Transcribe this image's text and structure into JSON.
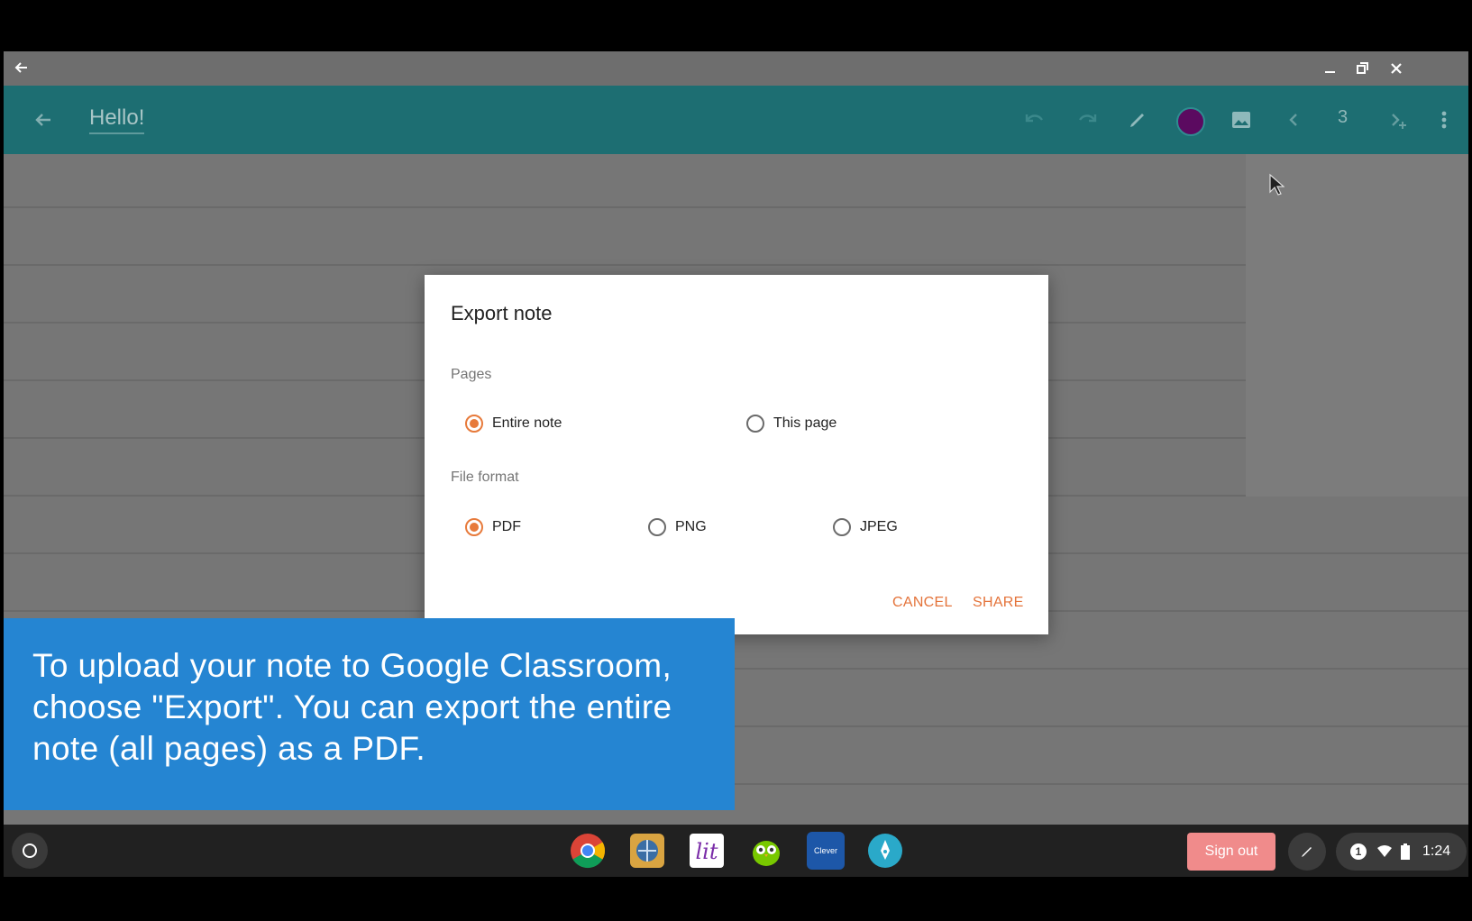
{
  "window": {
    "back_icon": "arrow-left-icon",
    "controls": [
      "minimize-icon",
      "restore-icon",
      "close-icon"
    ]
  },
  "toolbar": {
    "back_icon": "arrow-left-icon",
    "title": "Hello!",
    "icons": [
      "undo-icon",
      "redo-icon",
      "pen-icon",
      "color-swatch",
      "image-icon",
      "chevron-left-icon",
      "add-page-icon",
      "more-vert-icon"
    ],
    "pen_color": "#5b0a60",
    "page_number": "3"
  },
  "dialog": {
    "title": "Export note",
    "pages_label": "Pages",
    "pages_options": [
      {
        "label": "Entire note",
        "checked": true
      },
      {
        "label": "This page",
        "checked": false
      }
    ],
    "format_label": "File format",
    "format_options": [
      {
        "label": "PDF",
        "checked": true
      },
      {
        "label": "PNG",
        "checked": false
      },
      {
        "label": "JPEG",
        "checked": false
      }
    ],
    "cancel_label": "CANCEL",
    "share_label": "SHARE",
    "accent_color": "#e77a3b"
  },
  "caption": {
    "text": "To upload your note to Google Classroom, choose \"Export\". You can export the entire note (all pages) as a PDF."
  },
  "shelf": {
    "apps": [
      "chrome-icon",
      "globe-app-icon",
      "lit-app-icon",
      "owl-app-icon",
      "clever-app-icon",
      "pen-app-icon"
    ],
    "clever_label": "Clever",
    "sign_out_label": "Sign out",
    "notification_count": "1",
    "time": "1:24"
  }
}
